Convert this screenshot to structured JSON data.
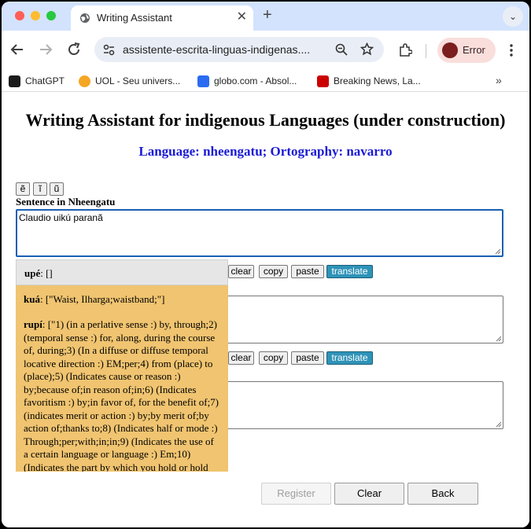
{
  "browser": {
    "tab_title": "Writing Assistant",
    "tab_close": "✕",
    "new_tab": "+",
    "tab_menu": "⌄",
    "url": "assistente-escrita-linguas-indigenas....",
    "profile_label": "Error",
    "bookmarks": [
      {
        "label": "ChatGPT",
        "icon": "chatgpt-icon",
        "color": "#111111"
      },
      {
        "label": "UOL - Seu univers...",
        "icon": "uol-icon",
        "color": "#f5a623"
      },
      {
        "label": "globo.com - Absol...",
        "icon": "globo-icon",
        "color": "#2a6bf2"
      },
      {
        "label": "Breaking News, La...",
        "icon": "cnn-icon",
        "color": "#cc0000"
      }
    ],
    "bookmarks_more": "»"
  },
  "page": {
    "title": "Writing Assistant for indigenous Languages (under construction)",
    "subtitle": "Language: nheengatu; Ortography: navarro",
    "special_chars": [
      "ẽ",
      "ĩ",
      "ũ"
    ],
    "sentence_label": "Sentence in Nheengatu",
    "sentence_value": "Claudio uikú paranã",
    "row_buttons": {
      "clear": "clear",
      "copy": "copy",
      "paste": "paste",
      "translate": "translate"
    },
    "bottom_buttons": {
      "register": "Register",
      "clear": "Clear",
      "back": "Back"
    },
    "suggestions": [
      {
        "word": "upé",
        "gloss": ": []"
      },
      {
        "word": "kuá",
        "gloss": ": [\"Waist, Ilharga;waistband;\"]"
      },
      {
        "word": "rupí",
        "gloss": ": [\"1) (in a perlative sense :) by, through;2) (temporal sense :) for, along, during the course of, during;3) (In a diffuse or diffuse temporal locative direction :) EM;per;4) from (place) to (place);5) (Indicates cause or reason :) by;because of;in reason of;in;6) (Indicates favoritism :) by;in favor of, for the benefit of;7) (indicates merit or action :) by;by merit of;by action of;thanks to;8) (Indicates half or mode :) Through;per;with;in;in;9) (Indicates the use of a certain language or language :) Em;10) (Indicates the part by which you hold or hold"
      }
    ]
  },
  "colors": {
    "tabstrip": "#d3e3fd",
    "subtitle": "#1a1ad6",
    "translate_button": "#2f93b8",
    "dropdown": "#f0c470",
    "focus_ring": "#1a5fb4"
  }
}
